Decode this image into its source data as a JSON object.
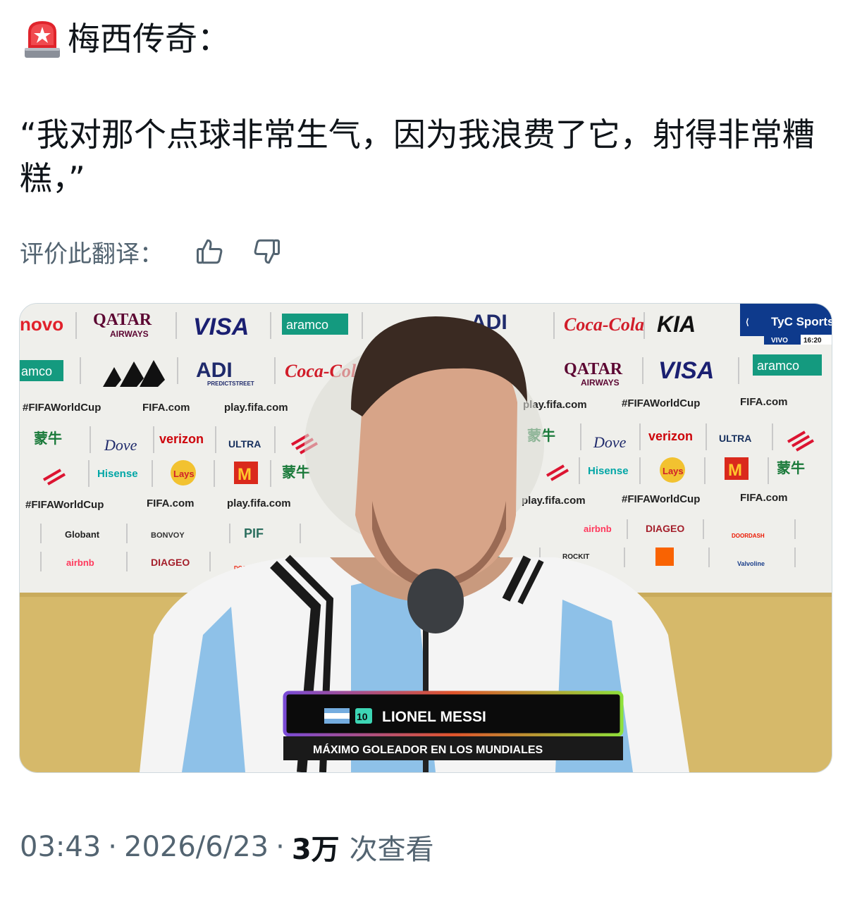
{
  "post": {
    "header_title": "梅西传奇：",
    "quote_text": "“我对那个点球非常生气，因为我浪费了它，射得非常糟糕，”",
    "rate_label": "评价此翻译："
  },
  "media": {
    "board": {
      "qatar": "QATAR",
      "airways": "AIRWAYS",
      "visa": "VISA",
      "aramco": "aramco",
      "aramco_cut": "amco",
      "lenovo_cut": "novo",
      "adi": "ADI",
      "adi_sub": "PREDICTSTREET",
      "cocacola": "Coca-Cola",
      "kia": "KIA",
      "hashtag": "#FIFAWorldCup",
      "fifa_com": "FIFA.com",
      "play_fifa": "play.fifa.com",
      "mengniu": "蒙牛",
      "dove": "Dove",
      "verizon": "verizon",
      "michelob": "ULTRA",
      "hisense": "Hisense",
      "lays": "Lays",
      "mcdonalds": "M",
      "globant": "Globant",
      "bonvoy": "BONVOY",
      "pif": "PIF",
      "airbnb": "airbnb",
      "diageo": "DIAGEO",
      "doordash": "DOORDASH",
      "rockit": "ROCKIT",
      "valvoline": "Valvoline"
    },
    "broadcast": {
      "channel": "TyC Sports",
      "live_label": "VIVO",
      "time": "16:20"
    },
    "lower_third": {
      "number": "10",
      "name": "LIONEL MESSI",
      "subtitle": "MÁXIMO GOLEADOR EN LOS MUNDIALES"
    }
  },
  "meta": {
    "time": "03:43",
    "separator": "·",
    "date": "2026/6/23",
    "views_count": "3万",
    "views_label": "次查看"
  },
  "colors": {
    "muted_text": "#536471",
    "main_text": "#0f1419",
    "wall": "#efefeb",
    "wall_gold": "#d6b96a",
    "siren_red": "#e0242c"
  },
  "icons": [
    "siren-icon",
    "thumbs-up-icon",
    "thumbs-down-icon"
  ]
}
